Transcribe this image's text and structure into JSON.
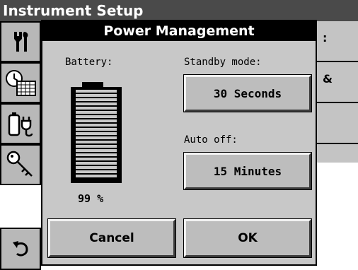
{
  "background": {
    "header_title": "Instrument Setup",
    "right_panel_texts": [
      ":",
      "&"
    ],
    "sidebar_icons": [
      "tools-icon",
      "clock-calendar-icon",
      "battery-plug-icon",
      "key-icon",
      "",
      "back-arrow-icon"
    ]
  },
  "dialog": {
    "title": "Power Management",
    "battery_label": "Battery:",
    "battery_percent_text": "99 %",
    "battery_level": 0.99,
    "standby_label": "Standby mode:",
    "standby_value": "30 Seconds",
    "autooff_label": "Auto off:",
    "autooff_value": "15 Minutes",
    "cancel_label": "Cancel",
    "ok_label": "OK"
  },
  "colors": {
    "dialog_bg": "#c8c8c8",
    "title_bar": "#000000",
    "header_bar": "#4a4a4a",
    "button_face": "#bdbdbd"
  }
}
